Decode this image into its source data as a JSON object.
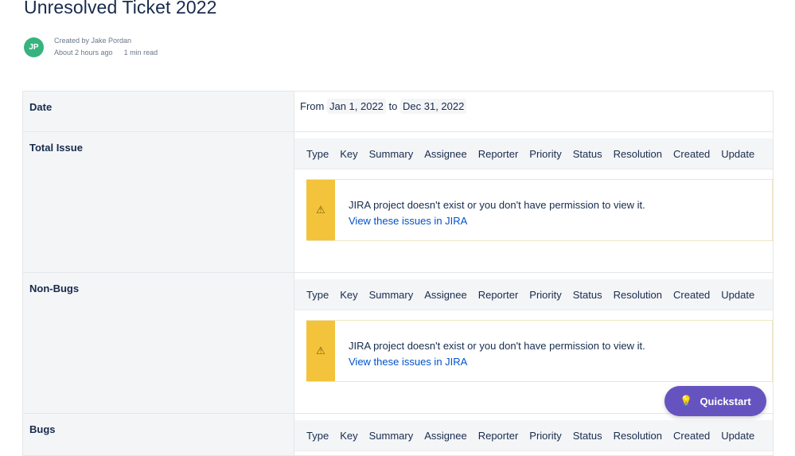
{
  "page": {
    "title": "Unresolved Ticket 2022"
  },
  "byline": {
    "avatar_initials": "JP",
    "created_by": "Created by Jake Pordan",
    "time_ago": "About 2 hours ago",
    "read_time": "1 min read"
  },
  "table": {
    "date_row": {
      "label": "Date",
      "from_word": "From",
      "from_date": "Jan 1, 2022",
      "to_word": "to",
      "to_date": "Dec 31, 2022"
    },
    "sections": [
      {
        "label": "Total Issue",
        "columns": [
          "Type",
          "Key",
          "Summary",
          "Assignee",
          "Reporter",
          "Priority",
          "Status",
          "Resolution",
          "Created",
          "Update"
        ],
        "message": "JIRA project doesn't exist or you don't have permission to view it.",
        "link": "View these issues in JIRA"
      },
      {
        "label": "Non-Bugs",
        "columns": [
          "Type",
          "Key",
          "Summary",
          "Assignee",
          "Reporter",
          "Priority",
          "Status",
          "Resolution",
          "Created",
          "Update"
        ],
        "message": "JIRA project doesn't exist or you don't have permission to view it.",
        "link": "View these issues in JIRA"
      },
      {
        "label": "Bugs",
        "columns": [
          "Type",
          "Key",
          "Summary",
          "Assignee",
          "Reporter",
          "Priority",
          "Status",
          "Resolution",
          "Created",
          "Update"
        ]
      }
    ]
  },
  "quickstart": {
    "label": "Quickstart",
    "icon": "lightbulb-icon"
  },
  "colors": {
    "avatar": "#36b37e",
    "warning": "#f3c33c",
    "link": "#0052cc",
    "quickstart": "#6554c0"
  }
}
